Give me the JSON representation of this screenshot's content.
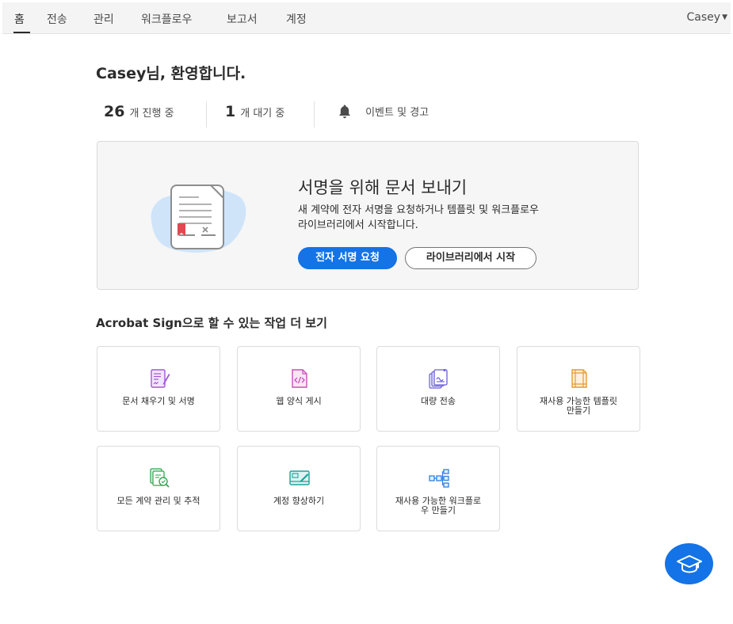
{
  "nav": {
    "items": [
      {
        "label": "홈",
        "active": true
      },
      {
        "label": "전송"
      },
      {
        "label": "관리"
      },
      {
        "label": "워크플로우"
      },
      {
        "label": "보고서"
      },
      {
        "label": "계정"
      }
    ],
    "user": "Casey"
  },
  "welcome": "Casey님, 환영합니다.",
  "stats": {
    "in_progress": {
      "count": "26",
      "label": "개 진행 중"
    },
    "waiting": {
      "count": "1",
      "label": "개 대기 중"
    },
    "events": {
      "label": "이벤트 및 경고",
      "icon": "bell-icon"
    }
  },
  "hero": {
    "title": "서명을 위해 문서 보내기",
    "desc_line1": "새 계약에 전자 서명을 요청하거나 템플릿 및 워크플로우",
    "desc_line2": "라이브러리에서 시작합니다.",
    "primary_button": "전자 서명 요청",
    "secondary_button": "라이브러리에서 시작"
  },
  "more_section_title": "Acrobat Sign으로 할 수 있는 작업 더 보기",
  "cards": [
    {
      "label": "문서 채우기 및 서명",
      "icon": "fill-sign-icon",
      "color": "#a356d6"
    },
    {
      "label": "웹 양식 게시",
      "icon": "web-form-icon",
      "color": "#c94fb8"
    },
    {
      "label": "대량 전송",
      "icon": "bulk-send-icon",
      "color": "#6b5fd6"
    },
    {
      "label_line1": "재사용 가능한 템플릿",
      "label_line2": "만들기",
      "icon": "template-icon",
      "color": "#e89a2c"
    },
    {
      "label": "모든 계약 관리 및 추적",
      "icon": "manage-track-icon",
      "color": "#33a852"
    },
    {
      "label": "계정 향상하기",
      "icon": "account-upgrade-icon",
      "color": "#19a39b"
    },
    {
      "label_line1": "재사용 가능한 워크플로",
      "label_line2": "우 만들기",
      "icon": "workflow-icon",
      "color": "#2f7fe0"
    }
  ],
  "colors": {
    "accent": "#1473e6",
    "nav_bg": "#f4f4f4",
    "hero_bg": "#f6f6f6"
  },
  "help_button_icon": "graduation-cap-icon"
}
